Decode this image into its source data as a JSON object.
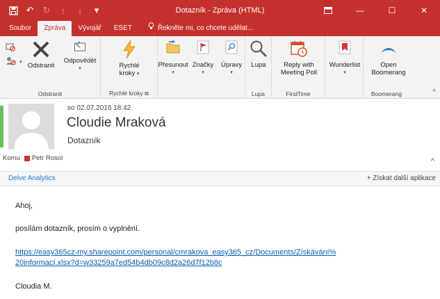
{
  "window": {
    "title": "Dotazník - Zpráva (HTML)",
    "color_accent": "#c4302b"
  },
  "tabs": [
    {
      "label": "Soubor",
      "active": false
    },
    {
      "label": "Zpráva",
      "active": true
    },
    {
      "label": "Vývojář",
      "active": false
    },
    {
      "label": "ESET",
      "active": false
    }
  ],
  "tell_me": "Řekněte mi, co chcete udělat...",
  "ribbon": {
    "odstranit_group": {
      "label": "Odstranit",
      "delete_label": "Odstranit",
      "reply_label": "Odpovědět"
    },
    "rychle_kroky_group": {
      "label": "Rychlé kroky",
      "button_label_1": "Rychlé",
      "button_label_2": "kroky"
    },
    "presunout": {
      "label": "Přesunout"
    },
    "znacky": {
      "label": "Značky"
    },
    "upravy": {
      "label": "Úpravy"
    },
    "lupa_group": {
      "label": "Lupa",
      "button_label": "Lupa"
    },
    "findtime_group": {
      "label": "FindTime",
      "button_label_1": "Reply with",
      "button_label_2": "Meeting Poll"
    },
    "wunderlist": {
      "label": "Wunderlist"
    },
    "boomerang_group": {
      "label": "Boomerang",
      "button_label_1": "Open",
      "button_label_2": "Boomerang"
    }
  },
  "message": {
    "date": "so 02.07.2016 18:42",
    "sender": "Cloudie Mraková",
    "subject": "Dotazník",
    "to_label": "Komu",
    "recipient": "Petr Rosol"
  },
  "addins": {
    "delve": "Delve Analytics",
    "get_more": "Získat další aplikace"
  },
  "body": {
    "greeting": "Ahoj,",
    "line1": "posílám dotazník, prosím o vyplnění.",
    "link_line1": "https://easy365cz-my.sharepoint.com/personal/cmrakova_easy365_cz/Documents/Získávání%",
    "link_line2": "20informací.xlsx?d=w33259a7ed54b4db09c8d2a26d7f12b8c",
    "signature": "Cloudia M."
  }
}
